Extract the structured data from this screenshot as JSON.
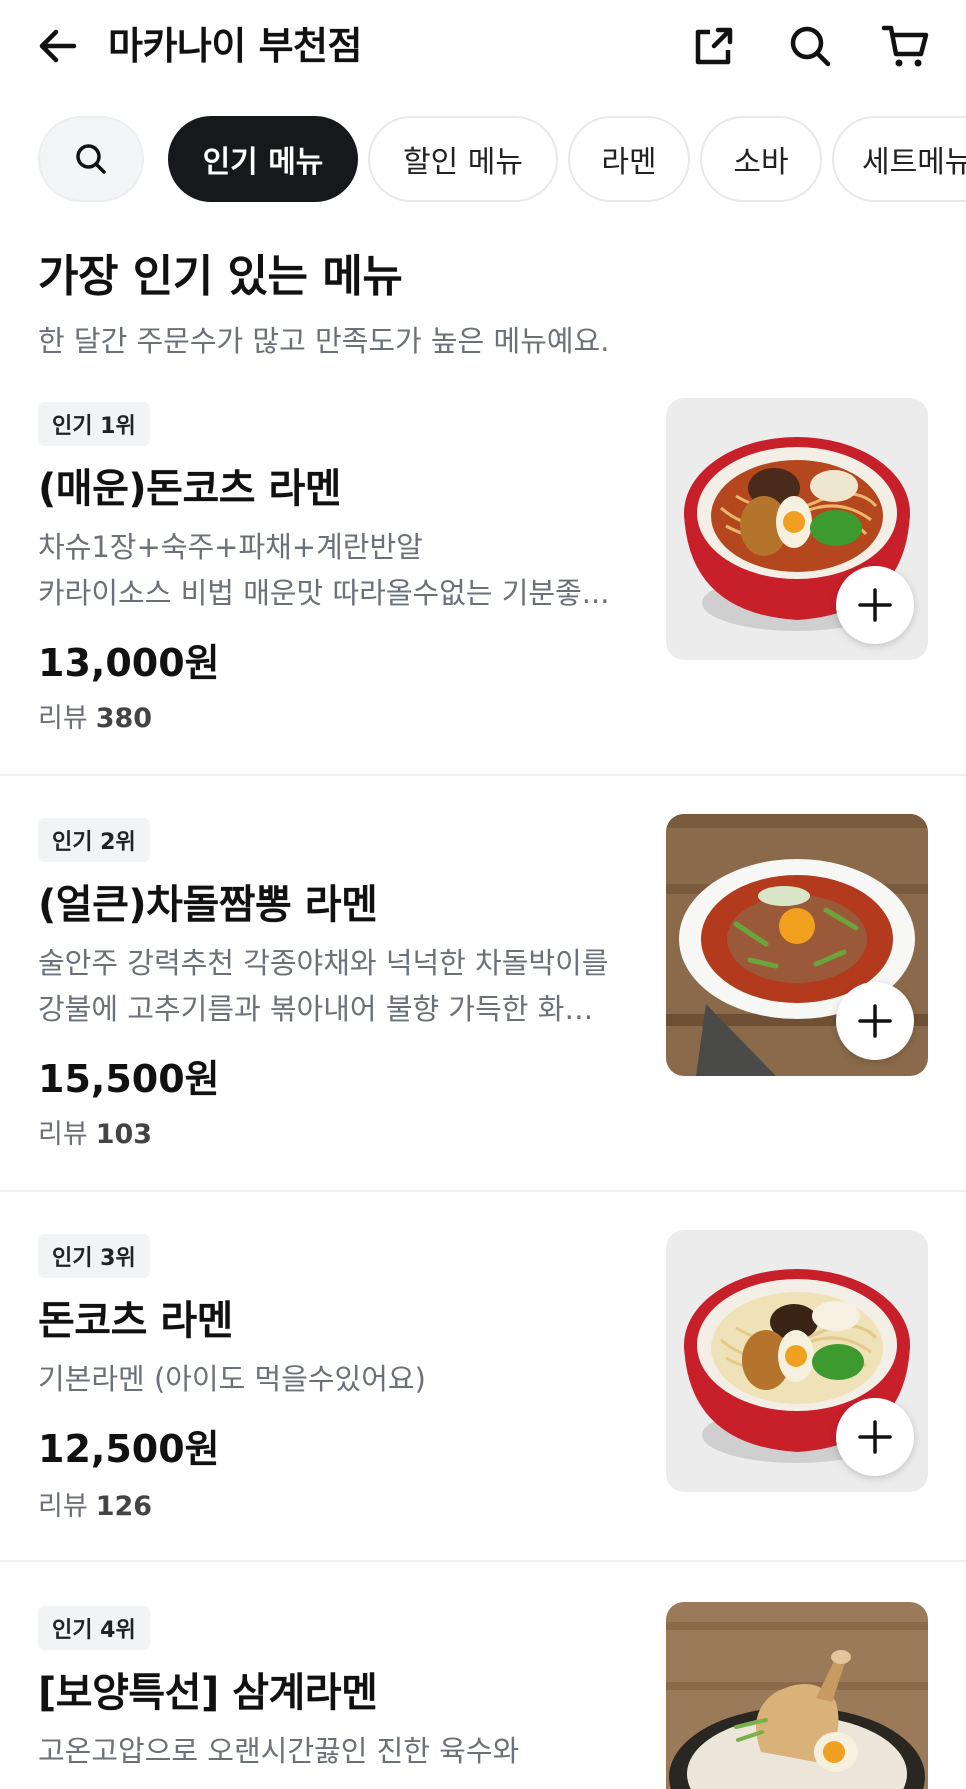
{
  "header": {
    "title": "마카나이 부천점",
    "back_icon": "arrow-left-icon",
    "share_icon": "share-icon",
    "search_icon": "search-icon",
    "cart_icon": "cart-icon"
  },
  "chips": {
    "search_icon": "search-icon",
    "items": [
      {
        "label": "인기 메뉴",
        "active": true
      },
      {
        "label": "할인 메뉴",
        "active": false
      },
      {
        "label": "라멘",
        "active": false
      },
      {
        "label": "소바",
        "active": false
      },
      {
        "label": "세트메뉴",
        "active": false
      }
    ]
  },
  "section": {
    "title": "가장 인기 있는 메뉴",
    "subtitle": "한 달간 주문수가 많고 만족도가 높은 메뉴예요."
  },
  "items": [
    {
      "rank": "인기 1위",
      "name": "(매운)돈코츠 라멘",
      "desc_line1": "차슈1장+숙주+파채+계란반알",
      "desc_line2": "카라이소스 비법 매운맛 따라올수없는 기분좋...",
      "price": "13,000원",
      "review_label": "리뷰",
      "review_count": "380"
    },
    {
      "rank": "인기 2위",
      "name": "(얼큰)차돌짬뽕 라멘",
      "desc_line1": "술안주 강력추천 각종야채와 넉넉한 차돌박이를",
      "desc_line2": "강불에 고추기름과 볶아내어 불향 가득한 화…",
      "price": "15,500원",
      "review_label": "리뷰",
      "review_count": "103"
    },
    {
      "rank": "인기 3위",
      "name": "돈코츠 라멘",
      "desc_line1": "기본라멘 (아이도 먹을수있어요)",
      "desc_line2": "",
      "price": "12,500원",
      "review_label": "리뷰",
      "review_count": "126"
    },
    {
      "rank": "인기 4위",
      "name": "[보양특선] 삼계라멘",
      "desc_line1": "고온고압으로 오랜시간끓인 진한 육수와",
      "desc_line2": "",
      "price": "",
      "review_label": "",
      "review_count": ""
    }
  ],
  "colors": {
    "active_chip_bg": "#16181b",
    "secondary_text": "#6b7079",
    "bowl_red": "#c8202a"
  }
}
